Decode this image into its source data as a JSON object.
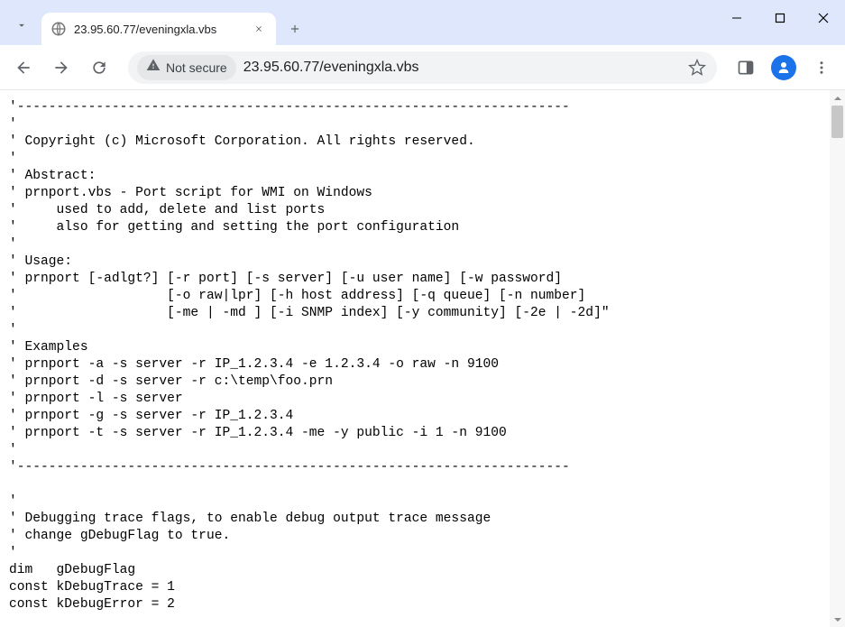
{
  "titlebar": {
    "tab_title": "23.95.60.77/eveningxla.vbs"
  },
  "toolbar": {
    "security_text": "Not secure",
    "url": "23.95.60.77/eveningxla.vbs"
  },
  "file": {
    "lines": [
      "'----------------------------------------------------------------------",
      "'",
      "' Copyright (c) Microsoft Corporation. All rights reserved.",
      "'",
      "' Abstract:",
      "' prnport.vbs - Port script for WMI on Windows",
      "'     used to add, delete and list ports",
      "'     also for getting and setting the port configuration",
      "'",
      "' Usage:",
      "' prnport [-adlgt?] [-r port] [-s server] [-u user name] [-w password]",
      "'                   [-o raw|lpr] [-h host address] [-q queue] [-n number]",
      "'                   [-me | -md ] [-i SNMP index] [-y community] [-2e | -2d]\"",
      "'",
      "' Examples",
      "' prnport -a -s server -r IP_1.2.3.4 -e 1.2.3.4 -o raw -n 9100",
      "' prnport -d -s server -r c:\\temp\\foo.prn",
      "' prnport -l -s server",
      "' prnport -g -s server -r IP_1.2.3.4",
      "' prnport -t -s server -r IP_1.2.3.4 -me -y public -i 1 -n 9100",
      "'",
      "'----------------------------------------------------------------------",
      "",
      "'",
      "' Debugging trace flags, to enable debug output trace message",
      "' change gDebugFlag to true.",
      "'",
      "dim   gDebugFlag",
      "const kDebugTrace = 1",
      "const kDebugError = 2"
    ]
  }
}
